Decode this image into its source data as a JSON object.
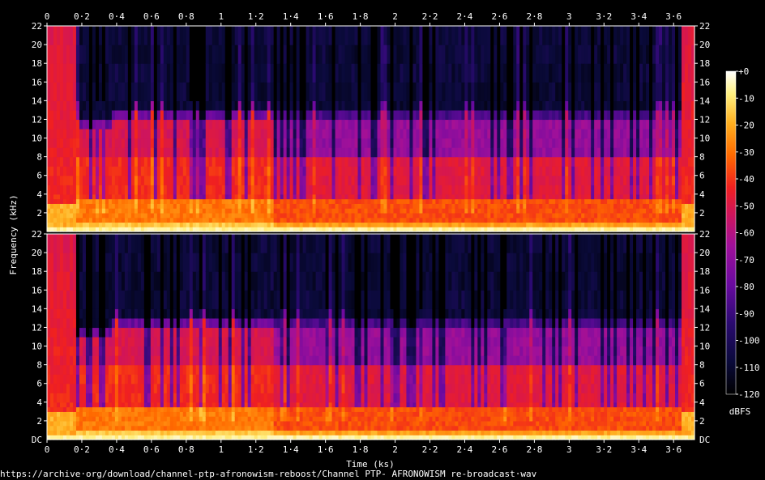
{
  "chart_data": {
    "type": "heatmap",
    "title": "",
    "xlabel": "Time (ks)",
    "ylabel": "Frequency (kHz)",
    "xlim": [
      0,
      3.72
    ],
    "x_ticks": [
      "0",
      "0·2",
      "0·4",
      "0·6",
      "0·8",
      "1",
      "1·2",
      "1·4",
      "1·6",
      "1·8",
      "2",
      "2·2",
      "2·4",
      "2·6",
      "2·8",
      "3",
      "3·2",
      "3·4",
      "3·6"
    ],
    "x_tick_values": [
      0,
      0.2,
      0.4,
      0.6,
      0.8,
      1.0,
      1.2,
      1.4,
      1.6,
      1.8,
      2.0,
      2.2,
      2.4,
      2.6,
      2.8,
      3.0,
      3.2,
      3.4,
      3.6
    ],
    "ylim": [
      0,
      22
    ],
    "y_ticks": [
      "2",
      "4",
      "6",
      "8",
      "10",
      "12",
      "14",
      "16",
      "18",
      "20",
      "22"
    ],
    "y_tick_values": [
      2,
      4,
      6,
      8,
      10,
      12,
      14,
      16,
      18,
      20,
      22
    ],
    "y_bottom_label": "DC",
    "channels": 2,
    "colorbar": {
      "label": "dBFS",
      "ticks": [
        "+0",
        "-10",
        "-20",
        "-30",
        "-40",
        "-50",
        "-60",
        "-70",
        "-80",
        "-90",
        "-100",
        "-110",
        "-120"
      ],
      "range": [
        -120,
        0
      ],
      "colors": [
        "#000000",
        "#0a0a3a",
        "#2a0a70",
        "#6a0aa0",
        "#a0109a",
        "#d0155a",
        "#f02020",
        "#ff6a00",
        "#ffb020",
        "#fff080",
        "#ffffff"
      ]
    },
    "segments": [
      {
        "t0": 0.0,
        "t1": 0.17,
        "cutoff_khz": 22,
        "level": "loud"
      },
      {
        "t0": 0.17,
        "t1": 0.37,
        "cutoff_khz": 12,
        "level": "mixed"
      },
      {
        "t0": 0.37,
        "t1": 1.31,
        "cutoff_khz": 13,
        "level": "mixed"
      },
      {
        "t0": 1.31,
        "t1": 3.65,
        "cutoff_khz": 13,
        "level": "steady"
      },
      {
        "t0": 3.65,
        "t1": 3.72,
        "cutoff_khz": 20,
        "level": "loud"
      }
    ]
  },
  "footer": {
    "path": "https://archive·org/download/channel-ptp-afronowism-reboost/Channel PTP- AFRONOWISM re-broadcast·wav"
  }
}
